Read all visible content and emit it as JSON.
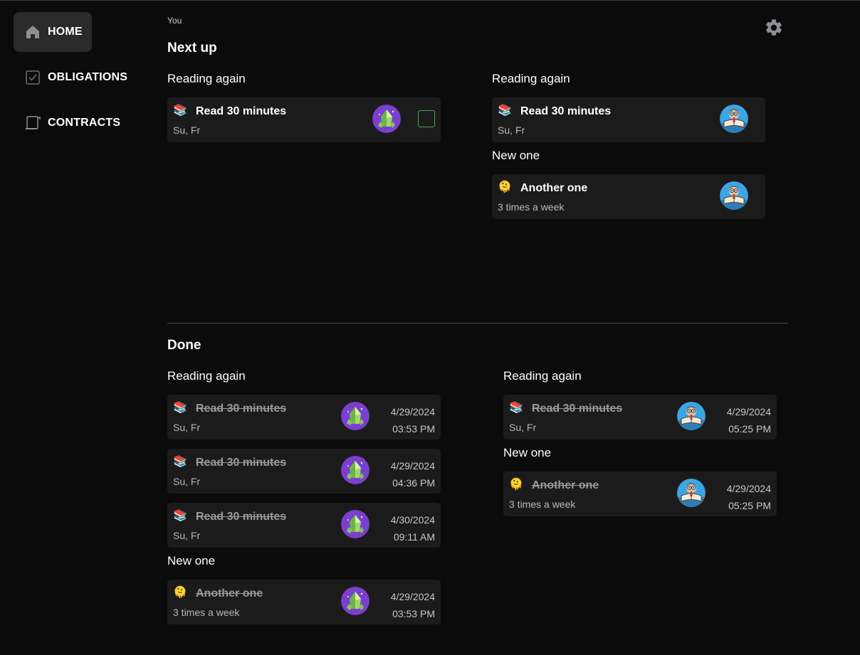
{
  "sidebar": {
    "items": [
      {
        "label": "HOME",
        "icon": "home-icon"
      },
      {
        "label": "OBLIGATIONS",
        "icon": "checkbox-icon"
      },
      {
        "label": "CONTRACTS",
        "icon": "scroll-icon"
      }
    ]
  },
  "header": {
    "user_label": "You",
    "settings_icon": "gear-icon"
  },
  "next_up": {
    "title": "Next up",
    "left": [
      {
        "group": "Reading again",
        "cards": [
          {
            "emoji": "📚",
            "title": "Read 30 minutes",
            "schedule": "Su, Fr",
            "avatar": "crystal-avatar",
            "checkbox": true
          }
        ]
      }
    ],
    "right": [
      {
        "group": "Reading again",
        "cards": [
          {
            "emoji": "📚",
            "title": "Read 30 minutes",
            "schedule": "Su, Fr",
            "avatar": "reader-avatar"
          }
        ]
      },
      {
        "group": "New one",
        "cards": [
          {
            "emoji": "🫠",
            "title": "Another one",
            "schedule": "3 times a week",
            "avatar": "reader-avatar"
          }
        ]
      }
    ]
  },
  "done": {
    "title": "Done",
    "left": [
      {
        "group": "Reading again",
        "cards": [
          {
            "emoji": "📚",
            "title": "Read 30 minutes",
            "schedule": "Su, Fr",
            "avatar": "crystal-avatar",
            "date": "4/29/2024",
            "time": "03:53 PM"
          },
          {
            "emoji": "📚",
            "title": "Read 30 minutes",
            "schedule": "Su, Fr",
            "avatar": "crystal-avatar",
            "date": "4/29/2024",
            "time": "04:36 PM"
          },
          {
            "emoji": "📚",
            "title": "Read 30 minutes",
            "schedule": "Su, Fr",
            "avatar": "crystal-avatar",
            "date": "4/30/2024",
            "time": "09:11 AM"
          }
        ]
      },
      {
        "group": "New one",
        "cards": [
          {
            "emoji": "🫠",
            "title": "Another one",
            "schedule": "3 times a week",
            "avatar": "crystal-avatar",
            "date": "4/29/2024",
            "time": "03:53 PM"
          }
        ]
      }
    ],
    "right": [
      {
        "group": "Reading again",
        "cards": [
          {
            "emoji": "📚",
            "title": "Read 30 minutes",
            "schedule": "Su, Fr",
            "avatar": "reader-avatar",
            "date": "4/29/2024",
            "time": "05:25 PM"
          }
        ]
      },
      {
        "group": "New one",
        "cards": [
          {
            "emoji": "🫠",
            "title": "Another one",
            "schedule": "3 times a week",
            "avatar": "reader-avatar",
            "date": "4/29/2024",
            "time": "05:25 PM"
          }
        ]
      }
    ]
  },
  "colors": {
    "background": "#0c0b0b",
    "card": "#1c1b1b",
    "checkbox_border": "#3fa55d",
    "crystal_avatar": "#7b3fd0",
    "reader_avatar": "#3aa6e6"
  }
}
